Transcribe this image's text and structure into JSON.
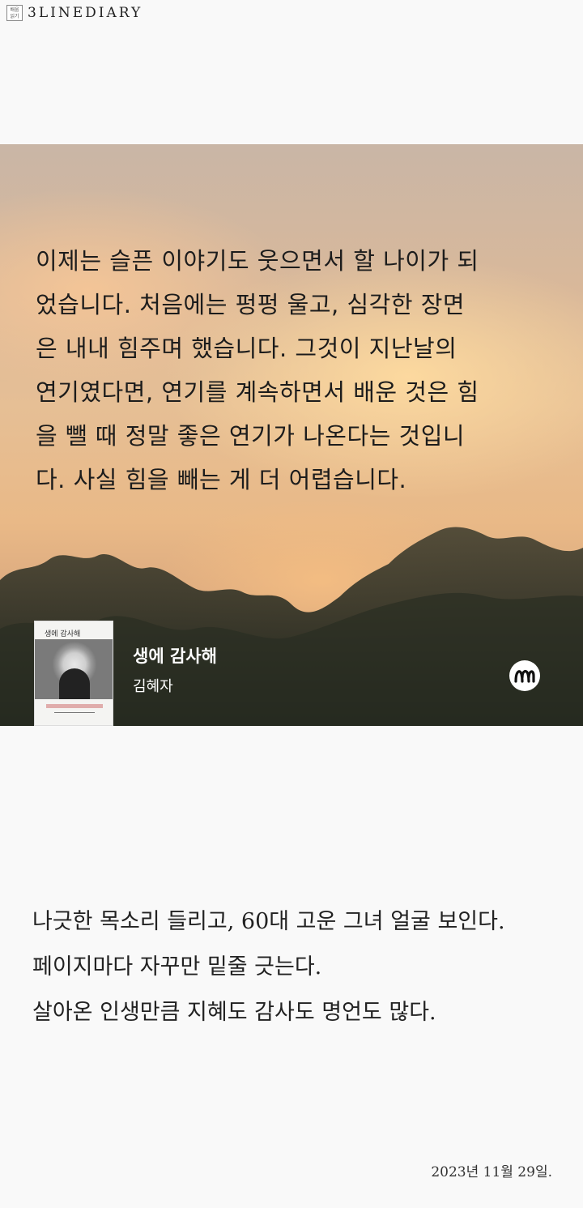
{
  "header": {
    "logo_box_text": "배움 읽기",
    "logo_text": "3LINEDIARY"
  },
  "quote_card": {
    "lines": [
      "이제는 슬픈 이야기도 웃으면서 할 나이가 되",
      "었습니다. 처음에는 펑펑 울고, 심각한 장면",
      "은 내내 힘주며 했습니다. 그것이 지난날의",
      "연기였다면, 연기를 계속하면서 배운 것은 힘",
      "을 뺄 때 정말 좋은 연기가 나온다는 것입니",
      "다. 사실 힘을 빼는 게 더 어렵습니다."
    ],
    "book_title": "생에 감사해",
    "book_author": "김혜자",
    "cover_title": "생에 감사해",
    "brand_icon": "m-logo-icon"
  },
  "diary": {
    "lines": [
      "나긋한 목소리 들리고, 60대 고운 그녀 얼굴 보인다.",
      "페이지마다 자꾸만 밑줄 긋는다.",
      "살아온 인생만큼 지혜도 감사도 명언도 많다."
    ],
    "date": "2023년 11월 29일."
  }
}
